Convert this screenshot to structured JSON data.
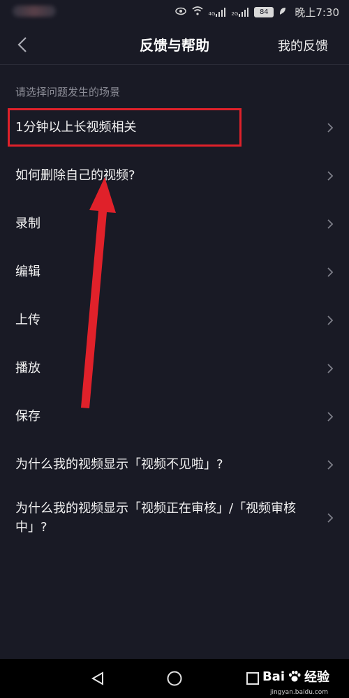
{
  "status_bar": {
    "network_4g": "4G",
    "network_2g": "2G",
    "battery": "84",
    "time": "晚上7:30"
  },
  "nav": {
    "title": "反馈与帮助",
    "right_link": "我的反馈"
  },
  "section": {
    "header": "请选择问题发生的场景"
  },
  "items": [
    {
      "label": "1分钟以上长视频相关"
    },
    {
      "label": "如何删除自己的视频?"
    },
    {
      "label": "录制"
    },
    {
      "label": "编辑"
    },
    {
      "label": "上传"
    },
    {
      "label": "播放"
    },
    {
      "label": "保存"
    },
    {
      "label": "为什么我的视频显示「视频不见啦」?"
    },
    {
      "label": "为什么我的视频显示「视频正在审核」/「视频审核中」?"
    }
  ],
  "watermark": {
    "brand_left": "Bai",
    "brand_right": "经验",
    "url": "jingyan.baidu.com"
  },
  "colors": {
    "background": "#191a25",
    "highlight": "#e0212a"
  }
}
